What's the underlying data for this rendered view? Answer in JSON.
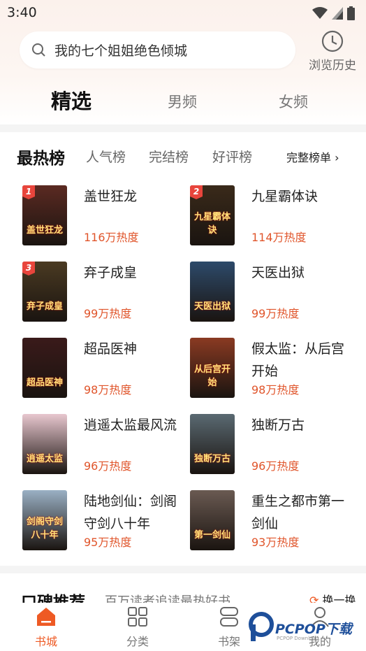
{
  "status": {
    "time": "3:40"
  },
  "search": {
    "placeholder": "我的七个姐姐绝色倾城",
    "icon": "search-icon"
  },
  "history": {
    "label": "浏览历史",
    "icon": "clock-icon"
  },
  "tabs": [
    {
      "label": "精选",
      "active": true
    },
    {
      "label": "男频",
      "active": false
    },
    {
      "label": "女频",
      "active": false
    }
  ],
  "ranking": {
    "title": "最热榜",
    "tabs": [
      "人气榜",
      "完结榜",
      "好评榜"
    ],
    "all_label": "完整榜单"
  },
  "books": [
    {
      "rank": "1",
      "title": "盖世狂龙",
      "heat": "116万热度",
      "cover_text": "盖世狂龙",
      "cover_color": "#5b2a22"
    },
    {
      "rank": "2",
      "title": "九星霸体诀",
      "heat": "114万热度",
      "cover_text": "九星霸体诀",
      "cover_color": "#3a2a1a"
    },
    {
      "rank": "3",
      "title": "弃子成皇",
      "heat": "99万热度",
      "cover_text": "弃子成皇",
      "cover_color": "#4a3a22"
    },
    {
      "rank": "",
      "title": "天医出狱",
      "heat": "99万热度",
      "cover_text": "天医出狱",
      "cover_color": "#2d4a6a"
    },
    {
      "rank": "",
      "title": "超品医神",
      "heat": "98万热度",
      "cover_text": "超品医神",
      "cover_color": "#3a1a1a"
    },
    {
      "rank": "",
      "title": "假太监：从后宫开始",
      "heat": "98万热度",
      "cover_text": "从后宫开始",
      "cover_color": "#8a3a22"
    },
    {
      "rank": "",
      "title": "逍遥太监最风流",
      "heat": "96万热度",
      "cover_text": "逍遥太监",
      "cover_color": "#e8c7cf"
    },
    {
      "rank": "",
      "title": "独断万古",
      "heat": "96万热度",
      "cover_text": "独断万古",
      "cover_color": "#5a6a72"
    },
    {
      "rank": "",
      "title": "陆地剑仙：剑阁守剑八十年",
      "heat": "95万热度",
      "cover_text": "剑阁守剑八十年",
      "cover_color": "#9ab0c4"
    },
    {
      "rank": "",
      "title": "重生之都市第一剑仙",
      "heat": "93万热度",
      "cover_text": "第一剑仙",
      "cover_color": "#6a5a52"
    }
  ],
  "recommend": {
    "title": "口碑推荐",
    "subtitle": "百万读者追读最热好书",
    "refresh": "换一换"
  },
  "nav": [
    {
      "label": "书城",
      "icon": "bookstore-icon",
      "active": true
    },
    {
      "label": "分类",
      "icon": "category-grid-icon",
      "active": false
    },
    {
      "label": "书架",
      "icon": "bookshelf-icon",
      "active": false
    },
    {
      "label": "我的",
      "icon": "profile-icon",
      "active": false
    }
  ],
  "watermark": {
    "text": "PCPOP下载",
    "sub": "PCPOP Download"
  },
  "colors": {
    "accent": "#ee5a24",
    "heat": "#e0552b"
  }
}
